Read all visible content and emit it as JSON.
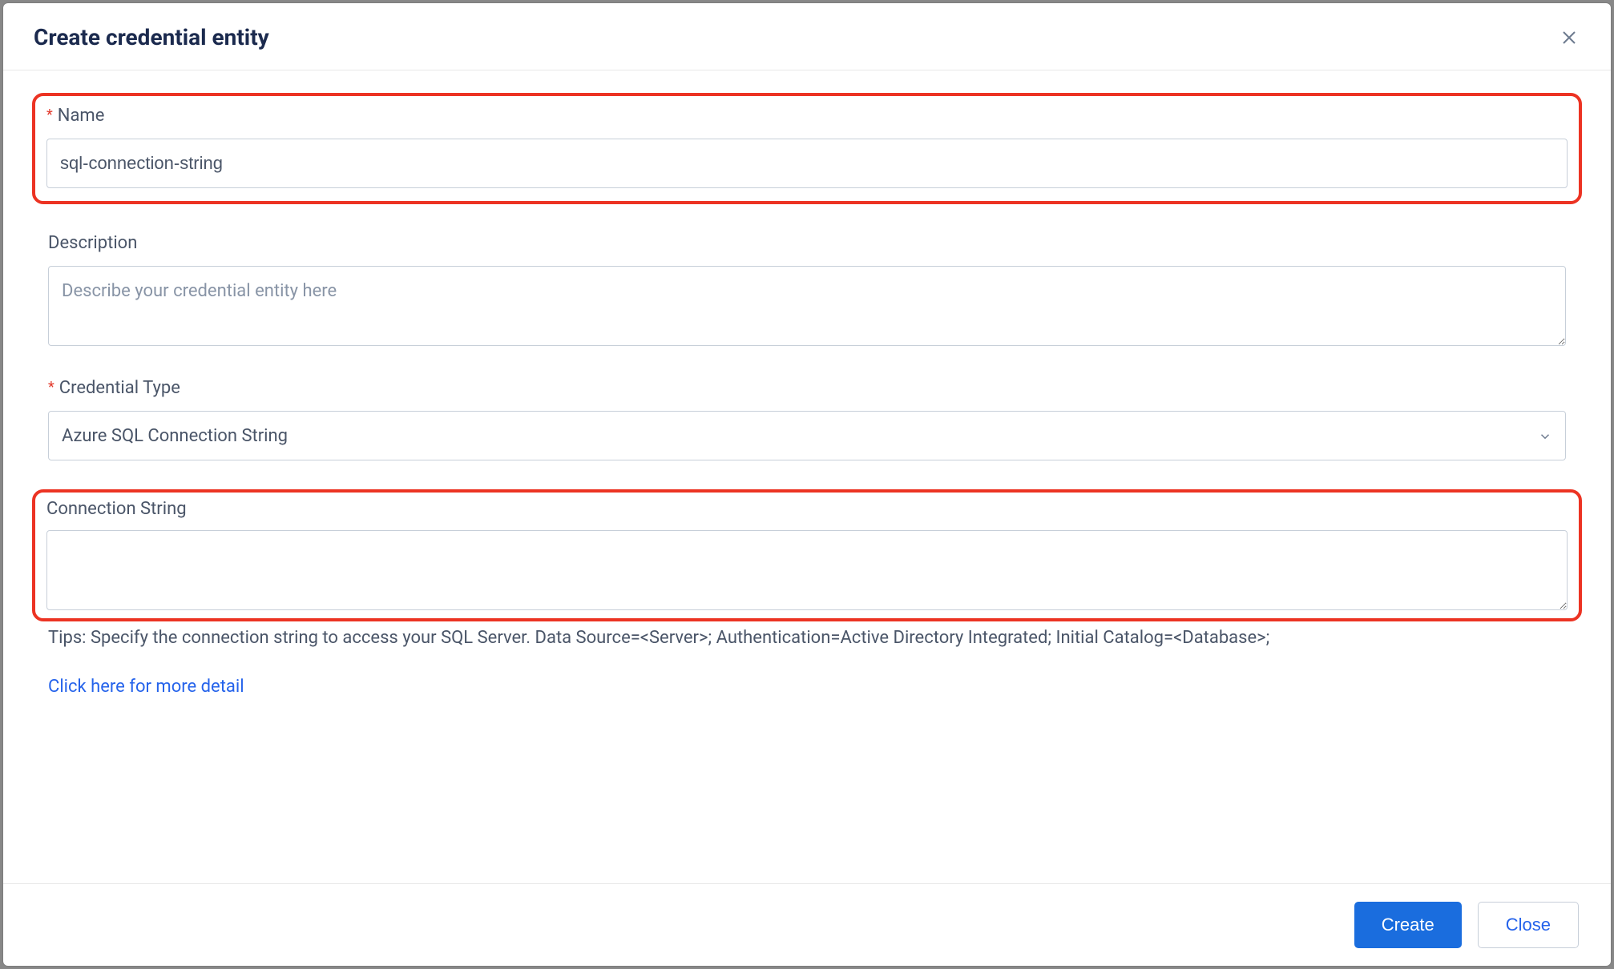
{
  "header": {
    "title": "Create credential entity"
  },
  "fields": {
    "name": {
      "label": "Name",
      "value": "sql-connection-string",
      "required": true
    },
    "description": {
      "label": "Description",
      "placeholder": "Describe your credential entity here",
      "value": ""
    },
    "credential_type": {
      "label": "Credential Type",
      "value": "Azure SQL Connection String",
      "required": true
    },
    "connection_string": {
      "label": "Connection String",
      "value": ""
    }
  },
  "tips": "Tips: Specify the connection string to access your SQL Server. Data Source=<Server>; Authentication=Active Directory Integrated; Initial Catalog=<Database>;",
  "link": "Click here for more detail",
  "buttons": {
    "create": "Create",
    "close": "Close"
  }
}
